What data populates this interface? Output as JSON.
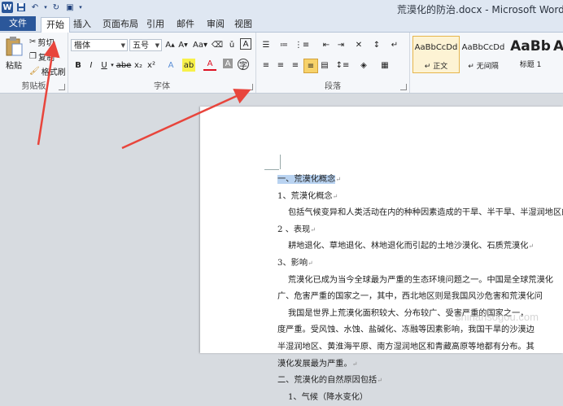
{
  "window": {
    "title": "荒漠化的防治.docx - Microsoft Word"
  },
  "qat": {
    "app_icon": "W"
  },
  "tabs": [
    {
      "label": "文件"
    },
    {
      "label": "开始"
    },
    {
      "label": "插入"
    },
    {
      "label": "页面布局"
    },
    {
      "label": "引用"
    },
    {
      "label": "邮件"
    },
    {
      "label": "审阅"
    },
    {
      "label": "视图"
    }
  ],
  "clipboard": {
    "paste": "粘贴",
    "cut": "剪切",
    "copy": "复制",
    "format_painter": "格式刷",
    "group_label": "剪贴板"
  },
  "font": {
    "name": "楷体",
    "size": "五号",
    "group_label": "字体"
  },
  "paragraph": {
    "group_label": "段落"
  },
  "styles": [
    {
      "preview": "AaBbCcDd",
      "name": "↵ 正文"
    },
    {
      "preview": "AaBbCcDd",
      "name": "↵ 无间隔"
    },
    {
      "preview": "AaBb",
      "name": "标题 1"
    },
    {
      "preview": "A",
      "name": ""
    }
  ],
  "document": {
    "lines": [
      "一、荒漠化概念",
      "1、荒漠化概念",
      "    包括气候变异和人类活动在内的种种因素造成的干旱、半干旱、半湿润地区的土地",
      "2 、表现",
      "    耕地退化、草地退化、林地退化而引起的土地沙漠化、石质荒漠化",
      "3、影响",
      "    荒漠化已成为当今全球最为严重的生态环境问题之一。中国是全球荒漠化",
      "广、危害严重的国家之一，其中，西北地区则是我国风沙危害和荒漠化问",
      "    我国是世界上荒漠化面积较大、分布较广、受害严重的国家之一，",
      "度严重。受风蚀、水蚀、盐碱化、冻融等因素影响，我国干旱的沙漠边",
      "半湿润地区、黄淮海平原、南方湿润地区和青藏高原等地都有分布。其",
      "漠化发展最为严重。",
      "二、荒漠化的自然原因包括",
      "    1、气候（降水变化）"
    ],
    "paragraph_mark": "↵"
  },
  "watermark": "shinansogou.com",
  "colors": {
    "file_tab": "#2b579a",
    "arrow": "#e8453c",
    "selection": "#b9d3f1"
  }
}
